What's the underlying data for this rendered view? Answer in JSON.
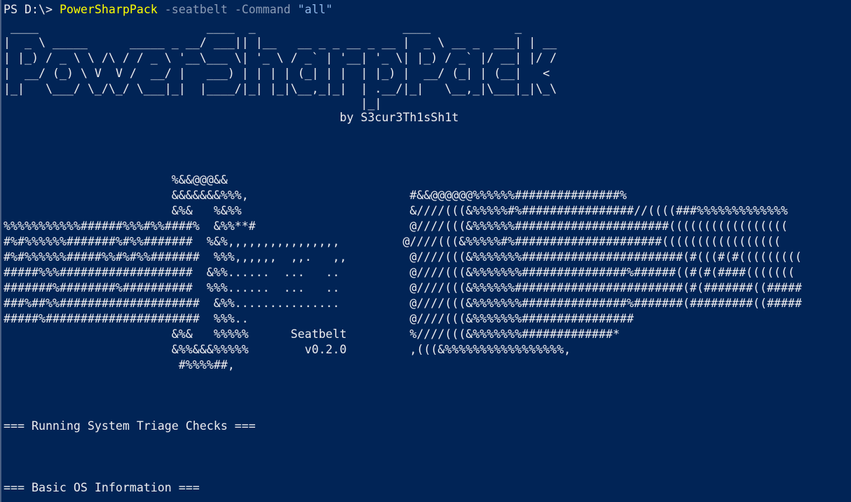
{
  "theme": {
    "background": "#012456",
    "foreground": "#eeedf0",
    "command_color": "#ffff00",
    "parameter_color": "#8a9bb6",
    "string_color": "#8fb7e8"
  },
  "prompt": {
    "path": "PS D:\\> ",
    "command": "PowerSharpPack",
    "parameters": " -seatbelt -Command ",
    "argument": "\"all\""
  },
  "banner": [
    " ____                        ____  _                     ____            _",
    "|  _ \\ _____      _____ _ __/ ___|| |__   __ _ _ __ _ __ |  _ \\ __ _  ___| | __",
    "| |_) / _ \\ \\ /\\ / / _ \\ '__\\___ \\| '_ \\ / _` | '__| '_ \\| |_) / _` |/ __| |/ /",
    "|  __/ (_) \\ V  V /  __/ |   ___) | | | | (_| | |  | |_) |  __/ (_| | (__|   <",
    "|_|   \\___/ \\_/\\_/ \\___|_|  |____/|_| |_|\\__,_|_|  | .__/|_|   \\__,_|\\___|_|\\_\\",
    "                                                   |_|",
    "                                                by S3cur3Th1sSh1t"
  ],
  "seatbelt_art": [
    "                        %&&@@@&&",
    "                        &&&&&&&%%%,                       #&&@@@@@@%%%%%%###############%",
    "                        &%&   %&%%                        &////(((&%%%%%#%################//((((###%%%%%%%%%%%%%",
    "%%%%%%%%%%%######%%%#%%####%  &%%**#                      @////(((&%%%%%%######################(((((((((((((((((",
    "#%#%%%%%%#######%#%%#######  %&%,,,,,,,,,,,,,,,,         @////(((&%%%%%#%#####################(((((((((((((((((",
    "#%#%%%%%%#####%%#%#%%#######  %%%,,,,,,  ,,.   ,,         @////(((&%%%%%%%#######################(#(((#(#(((((((((",
    "#####%%%###################  &%%......  ...   ..          @////(((&%%%%%%%###############%######((#(#(####(((((((",
    "#######%########%##########  %%%......  ...   ..          @////(((&%%%%%%########################(#(#######((#####",
    "###%##%%####################  &%%...............          @////(((&%%%%%%%###############%#######(#########((#####",
    "#####%######################  %%%..                       @////(((&%%%%%%%################",
    "                        &%&   %%%%%      Seatbelt         %////(((&%%%%%%%#############*",
    "                        &%%&&&%%%%%        v0.2.0         ,(((&%%%%%%%%%%%%%%%%%,",
    "                         #%%%%##,"
  ],
  "sections": [
    "=== Running System Triage Checks ===",
    "=== Basic OS Information ==="
  ]
}
